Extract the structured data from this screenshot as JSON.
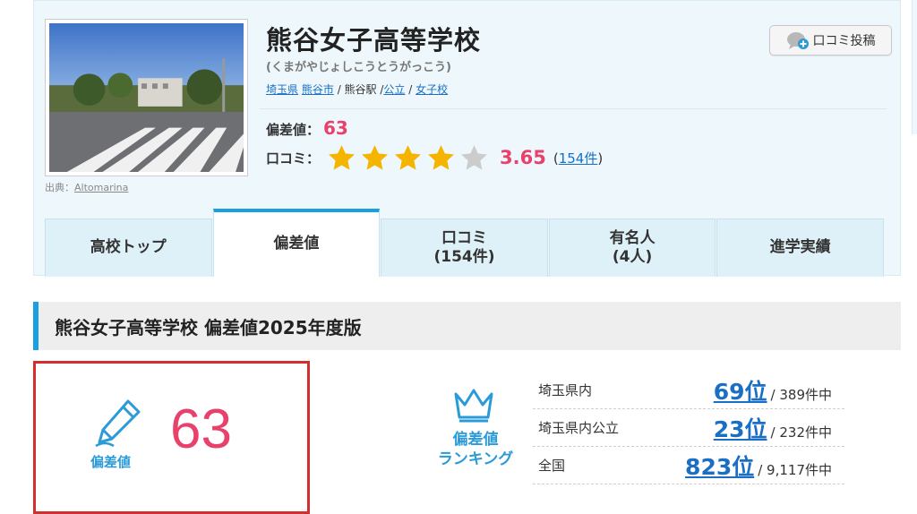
{
  "school": {
    "name": "熊谷女子高等学校",
    "kana": "(くまがやじょしこうとうがっこう)",
    "photo_credit_prefix": "出典：",
    "photo_credit_link": "Altomarina"
  },
  "breadcrumb": {
    "prefecture": "埼玉県",
    "city": "熊谷市",
    "station": "熊谷駅",
    "type": "公立",
    "gender": "女子校",
    "separator": " / "
  },
  "summary": {
    "deviation_label": "偏差値：",
    "deviation_value": "63",
    "review_label": "口コミ：",
    "rating": 3.65,
    "rating_text": "3.65",
    "review_count_open": "(",
    "review_count_link": "154件",
    "review_count_close": ")",
    "stars_filled": 4,
    "stars_total": 5
  },
  "post_button": {
    "label": "口コミ投稿",
    "icon": "speech-bubble-plus-icon"
  },
  "tabs": [
    {
      "line1": "高校トップ",
      "line2": "",
      "active": false
    },
    {
      "line1": "偏差値",
      "line2": "",
      "active": true
    },
    {
      "line1": "口コミ",
      "line2": "(154件)",
      "active": false
    },
    {
      "line1": "有名人",
      "line2": "(4人)",
      "active": false
    },
    {
      "line1": "進学実績",
      "line2": "",
      "active": false
    }
  ],
  "section": {
    "heading": "熊谷女子高等学校 偏差値2025年度版"
  },
  "deviation_box": {
    "label": "偏差値",
    "value": "63",
    "icon": "pencil-icon"
  },
  "ranking": {
    "label_line1": "偏差値",
    "label_line2": "ランキング",
    "icon": "crown-icon",
    "rows": [
      {
        "region": "埼玉県内",
        "rank": "69位",
        "total": "/ 389件中"
      },
      {
        "region": "埼玉県内公立",
        "rank": "23位",
        "total": "/ 232件中"
      },
      {
        "region": "全国",
        "rank": "823位",
        "total": "/ 9,117件中"
      }
    ]
  },
  "colors": {
    "accent": "#1aa0e0",
    "score": "#e8416c",
    "link": "#1a6fc4",
    "star": "#f5b400",
    "highlight_border": "#d42f2f"
  }
}
